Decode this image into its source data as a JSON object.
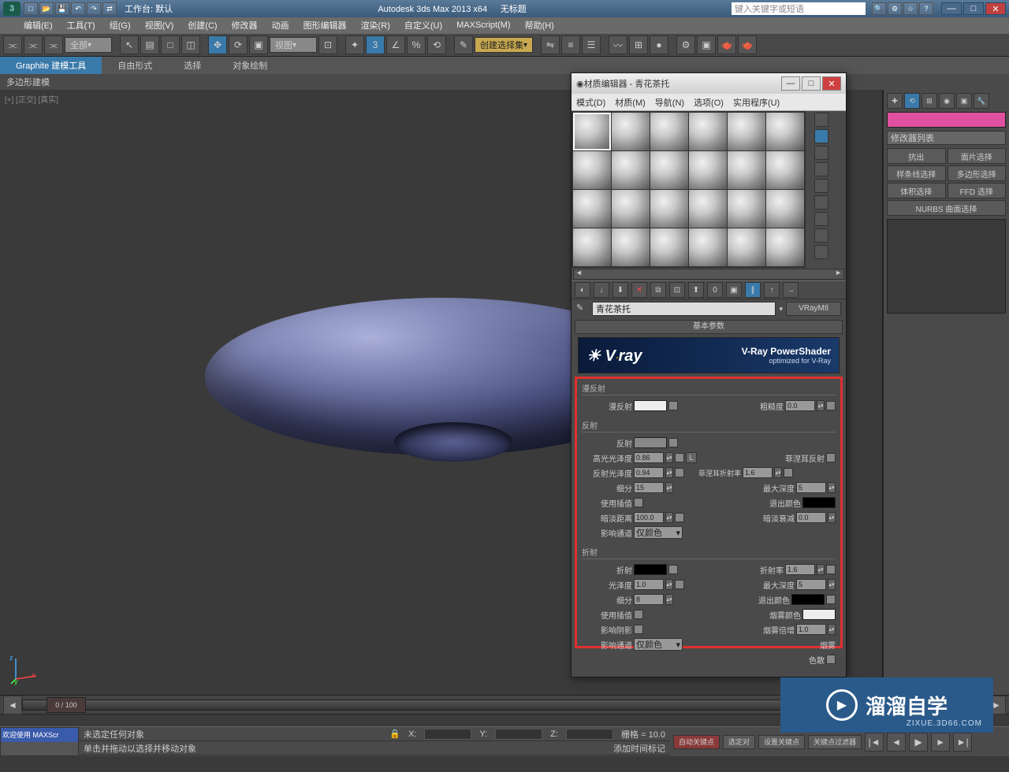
{
  "titlebar": {
    "workspace_label": "工作台: 默认",
    "app_title": "Autodesk 3ds Max  2013 x64",
    "doc_title": "无标题",
    "search_placeholder": "键入关键字或短语"
  },
  "menubar": [
    "编辑(E)",
    "工具(T)",
    "组(G)",
    "视图(V)",
    "创建(C)",
    "修改器",
    "动画",
    "图形编辑器",
    "渲染(R)",
    "自定义(U)",
    "MAXScript(M)",
    "帮助(H)"
  ],
  "toolbar": {
    "filter": "全部",
    "viewmode": "视图",
    "selset": "创建选择集"
  },
  "ribbon": {
    "tabs": [
      "Graphite 建模工具",
      "自由形式",
      "选择",
      "对象绘制"
    ],
    "sub": "多边形建模"
  },
  "viewport": {
    "label": "[+] [正交] [真实]"
  },
  "right_panel": {
    "modifier_list": "修改器列表",
    "buttons": [
      "抗出",
      "面片选择",
      "样条线选择",
      "多边形选择",
      "体积选择",
      "FFD 选择",
      "NURBS 曲面选择"
    ]
  },
  "mat_editor": {
    "title": "材质编辑器 - 青花茶托",
    "menus": [
      "模式(D)",
      "材质(M)",
      "导航(N)",
      "选项(O)",
      "实用程序(U)"
    ],
    "name": "青花茶托",
    "type": "VRayMtl",
    "rollout": "基本参数",
    "banner": {
      "logo": "V·ray",
      "line1": "V-Ray PowerShader",
      "line2": "optimized for V-Ray"
    },
    "groups": {
      "diffuse": {
        "title": "漫反射",
        "diffuse": "漫反射",
        "roughness": "粗糙度",
        "roughness_val": "0.0"
      },
      "reflect": {
        "title": "反射",
        "reflect": "反射",
        "hilight": "高光光泽度",
        "hilight_val": "0.86",
        "refl_gloss": "反射光泽度",
        "refl_gloss_val": "0.94",
        "subdiv": "细分",
        "subdiv_val": "15",
        "use_interp": "使用插值",
        "dim_dist": "暗淡距离",
        "dim_dist_val": "100.0",
        "affect_ch": "影响通道",
        "affect_ch_val": "仅颜色",
        "fresnel": "菲涅耳反射",
        "fresnel_ior": "菲涅耳折射率",
        "fresnel_ior_val": "1.6",
        "max_depth": "最大深度",
        "max_depth_val": "5",
        "exit_color": "退出颜色",
        "dim_falloff": "暗淡衰减",
        "dim_falloff_val": "0.0"
      },
      "refract": {
        "title": "折射",
        "refract": "折射",
        "glossiness": "光泽度",
        "glossiness_val": "1.0",
        "subdiv": "细分",
        "subdiv_val": "8",
        "use_interp": "使用插值",
        "affect_shadow": "影响阴影",
        "affect_ch": "影响通道",
        "affect_ch_val": "仅颜色",
        "ior": "折射率",
        "ior_val": "1.6",
        "max_depth": "最大深度",
        "max_depth_val": "5",
        "exit_color": "退出颜色",
        "fog_color": "烟雾颜色",
        "fog_mult": "烟雾倍增",
        "fog_mult_val": "1.0",
        "fog_bias": "烟雾",
        "dispersion": "色散"
      }
    }
  },
  "timeline": {
    "frame": "0 / 100"
  },
  "status": {
    "welcome": "欢迎使用  MAXScr",
    "line1": "未选定任何对象",
    "line2": "单击并拖动以选择并移动对象",
    "grid": "栅格 = 10.0",
    "add_time": "添加时间标记",
    "auto_key": "自动关键点",
    "set_key": "设置关键点",
    "sel_lock": "选定对",
    "key_filter": "关键点过滤器"
  },
  "coords": {
    "x": "X:",
    "y": "Y:",
    "z": "Z:"
  },
  "watermark": {
    "text": "溜溜自学",
    "url": "ZIXUE.3D66.COM"
  }
}
